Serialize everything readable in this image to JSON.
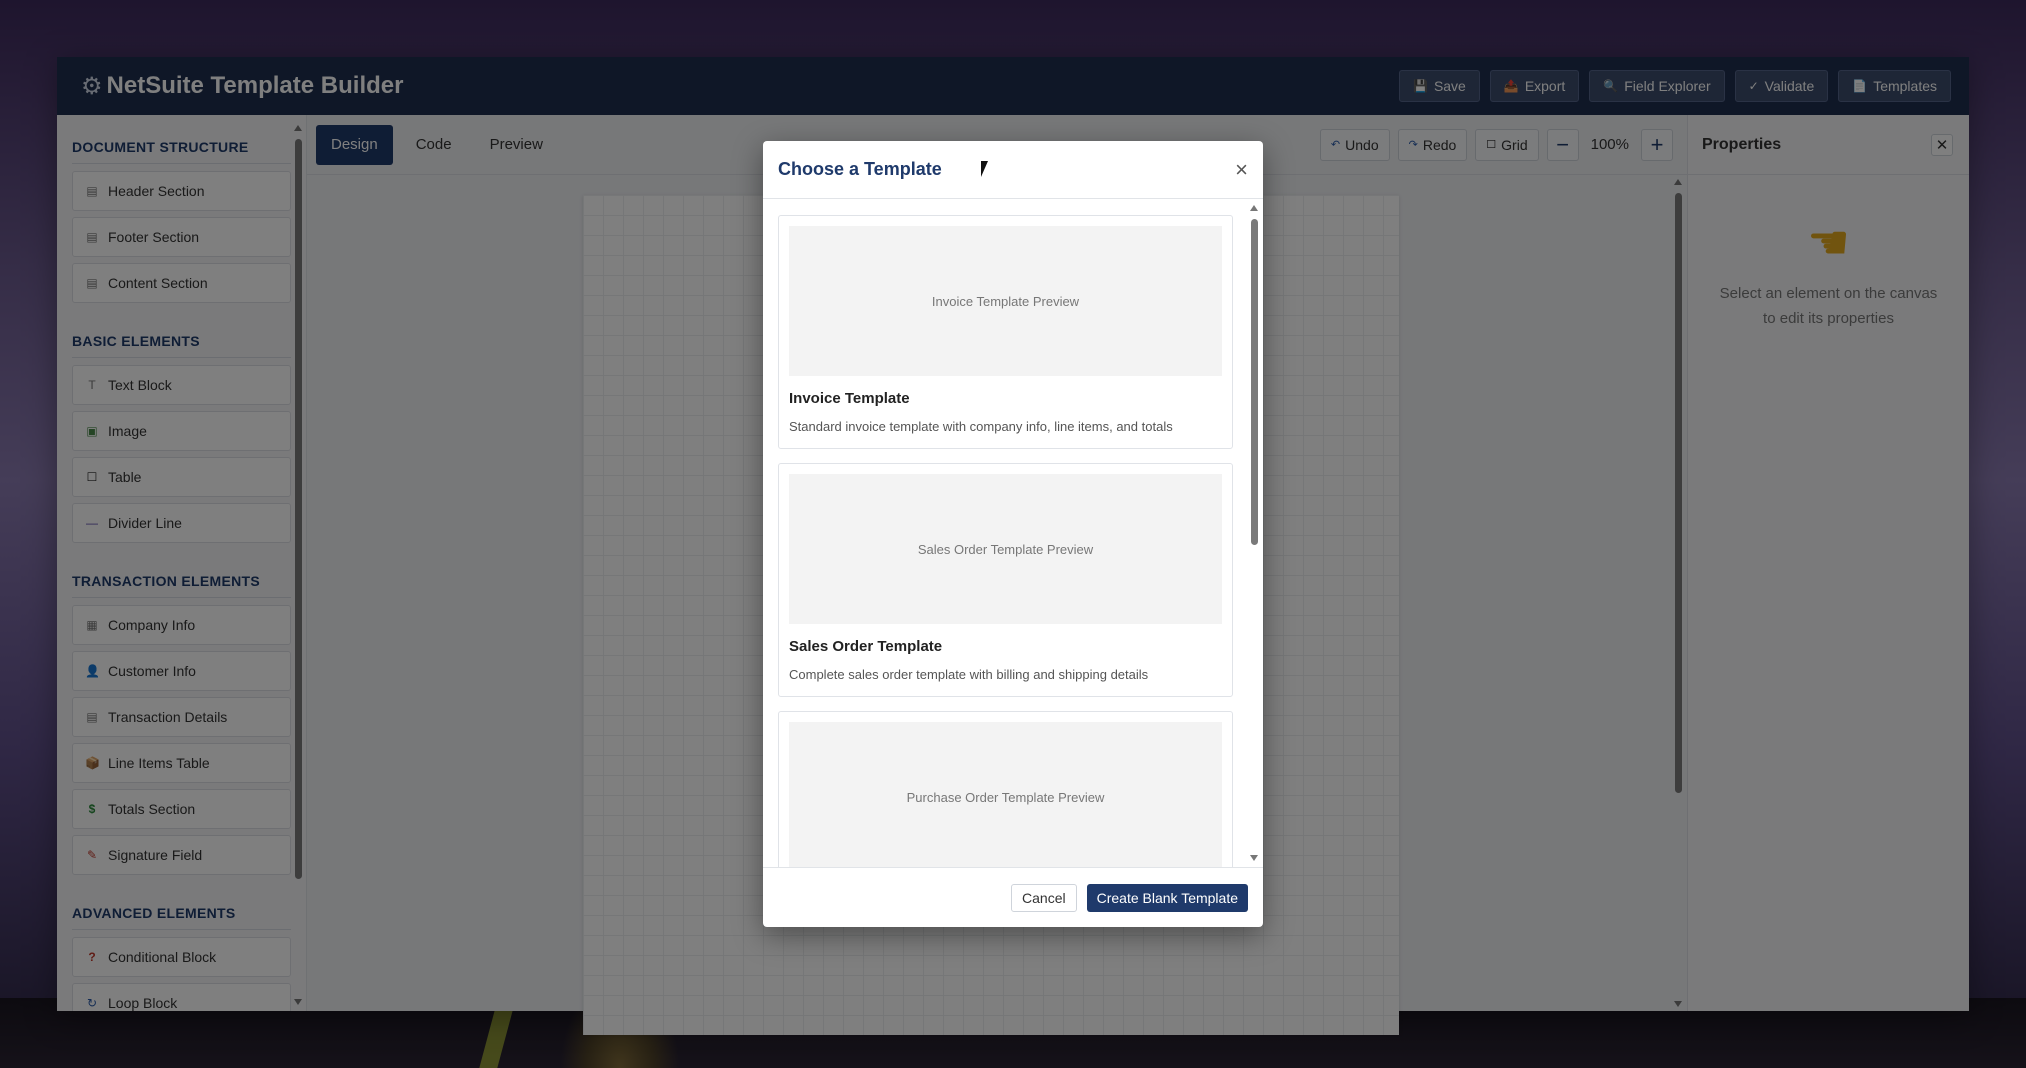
{
  "app": {
    "title": "NetSuite Template Builder",
    "top_actions": [
      {
        "label": "Save",
        "icon": "💾"
      },
      {
        "label": "Export",
        "icon": "📤"
      },
      {
        "label": "Field Explorer",
        "icon": "🔍"
      },
      {
        "label": "Validate",
        "icon": "✓"
      },
      {
        "label": "Templates",
        "icon": "📄"
      }
    ]
  },
  "sidebar": {
    "sections": [
      {
        "title": "DOCUMENT STRUCTURE",
        "items": [
          {
            "label": "Header Section",
            "icon": "▤"
          },
          {
            "label": "Footer Section",
            "icon": "▤"
          },
          {
            "label": "Content Section",
            "icon": "▤"
          }
        ]
      },
      {
        "title": "BASIC ELEMENTS",
        "items": [
          {
            "label": "Text Block",
            "icon": "T"
          },
          {
            "label": "Image",
            "icon": "▣"
          },
          {
            "label": "Table",
            "icon": "☐"
          },
          {
            "label": "Divider Line",
            "icon": "—"
          }
        ]
      },
      {
        "title": "TRANSACTION ELEMENTS",
        "items": [
          {
            "label": "Company Info",
            "icon": "▦"
          },
          {
            "label": "Customer Info",
            "icon": "👤"
          },
          {
            "label": "Transaction Details",
            "icon": "▤"
          },
          {
            "label": "Line Items Table",
            "icon": "📦"
          },
          {
            "label": "Totals Section",
            "icon": "$"
          },
          {
            "label": "Signature Field",
            "icon": "✎"
          }
        ]
      },
      {
        "title": "ADVANCED ELEMENTS",
        "items": [
          {
            "label": "Conditional Block",
            "icon": "?"
          },
          {
            "label": "Loop Block",
            "icon": "↻"
          }
        ]
      }
    ]
  },
  "canvas": {
    "tabs": [
      "Design",
      "Code",
      "Preview"
    ],
    "tools": {
      "undo": "Undo",
      "redo": "Redo",
      "grid": "Grid",
      "zoom": "100%"
    }
  },
  "properties": {
    "title": "Properties",
    "hint": "Select an element on the canvas to edit its properties"
  },
  "modal": {
    "title": "Choose a Template",
    "templates": [
      {
        "preview": "Invoice Template Preview",
        "name": "Invoice Template",
        "desc": "Standard invoice template with company info, line items, and totals"
      },
      {
        "preview": "Sales Order Template Preview",
        "name": "Sales Order Template",
        "desc": "Complete sales order template with billing and shipping details"
      },
      {
        "preview": "Purchase Order Template Preview",
        "name": "",
        "desc": ""
      }
    ],
    "cancel": "Cancel",
    "create_blank": "Create Blank Template"
  },
  "colors": {
    "primary": "#1f3a6b",
    "topbar": "#1f2f4f"
  }
}
